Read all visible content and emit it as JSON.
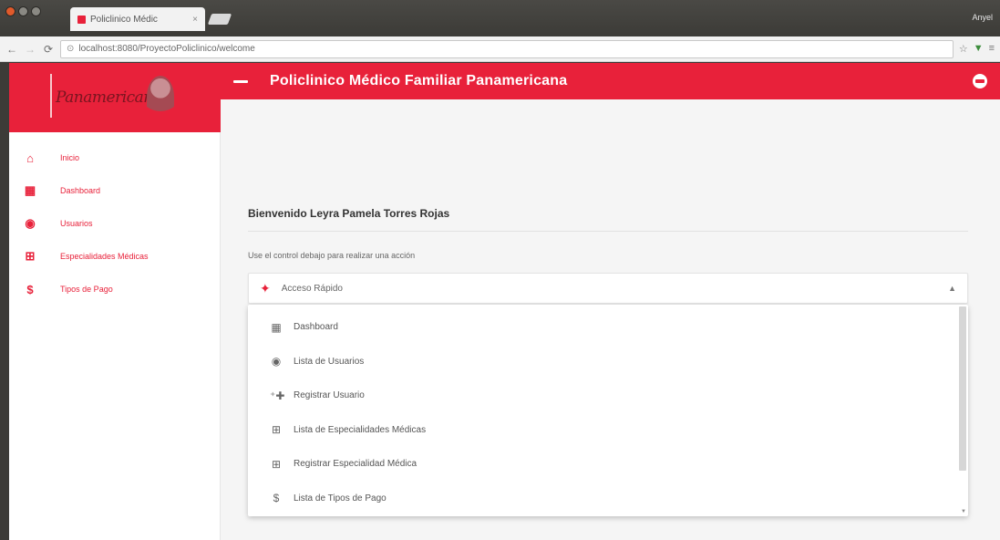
{
  "browser": {
    "tab_title": "Policlinico Médic",
    "tab_close": "×",
    "address": "localhost:8080/ProyectoPoliclinico/welcome",
    "user": "Anyel",
    "nav": {
      "back": "←",
      "forward": "→",
      "reload": "⟳"
    }
  },
  "app": {
    "title": "Policlinico Médico Familiar Panamericana",
    "logo_text": "Panamericana"
  },
  "sidebar": {
    "items": [
      {
        "icon": "home-icon",
        "glyph": "⌂",
        "label": "Inicio"
      },
      {
        "icon": "dashboard-icon",
        "glyph": "▦",
        "label": "Dashboard"
      },
      {
        "icon": "users-icon",
        "glyph": "◉",
        "label": "Usuarios"
      },
      {
        "icon": "specialties-icon",
        "glyph": "⊞",
        "label": "Especialidades Médicas"
      },
      {
        "icon": "dollar-icon",
        "glyph": "$",
        "label": "Tipos de Pago"
      }
    ]
  },
  "main": {
    "welcome": "Bienvenido Leyra Pamela Torres Rojas",
    "hint": "Use el control debajo para realizar una acción",
    "select": {
      "icon": "puzzle-icon",
      "glyph": "✦",
      "value": "Acceso Rápido",
      "caret": "▲"
    },
    "dropdown": [
      {
        "icon": "dashboard-icon",
        "glyph": "▦",
        "label": "Dashboard"
      },
      {
        "icon": "users-icon",
        "glyph": "◉",
        "label": "Lista de Usuarios"
      },
      {
        "icon": "add-user-icon",
        "glyph": "⁺✚",
        "label": "Registrar Usuario"
      },
      {
        "icon": "specialties-icon",
        "glyph": "⊞",
        "label": "Lista de Especialidades Médicas"
      },
      {
        "icon": "add-specialty-icon",
        "glyph": "⊞",
        "label": "Registrar Especialidad Médica"
      },
      {
        "icon": "dollar-icon",
        "glyph": "$",
        "label": "Lista de Tipos de Pago"
      }
    ]
  },
  "colors": {
    "brand": "#e8213a",
    "chrome": "#3c3b37"
  }
}
